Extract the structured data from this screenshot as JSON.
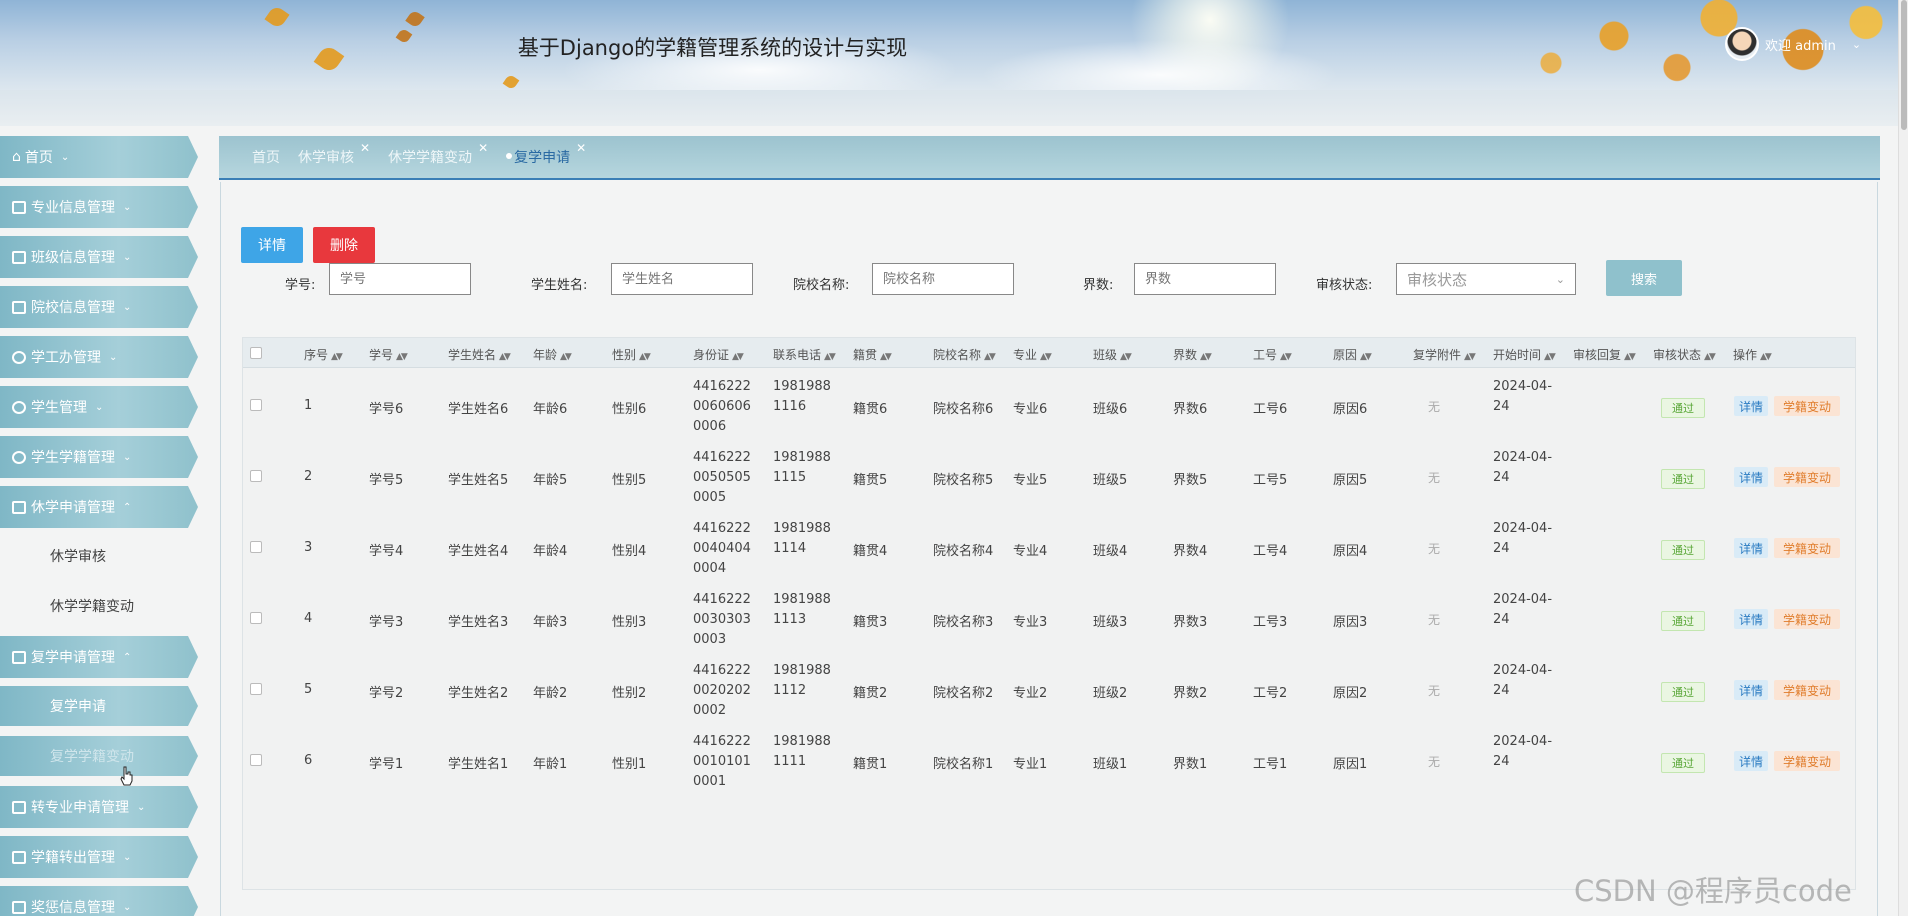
{
  "header": {
    "title": "基于Django的学籍管理系统的设计与实现",
    "welcome": "欢迎 admin"
  },
  "sidebar": {
    "items": [
      {
        "label": "首页",
        "icon": "home-icon"
      },
      {
        "label": "专业信息管理",
        "icon": "image-icon"
      },
      {
        "label": "班级信息管理",
        "icon": "table-icon"
      },
      {
        "label": "院校信息管理",
        "icon": "columns-icon"
      },
      {
        "label": "学工办管理",
        "icon": "user-icon"
      },
      {
        "label": "学生管理",
        "icon": "user-icon"
      },
      {
        "label": "学生学籍管理",
        "icon": "drop-icon"
      },
      {
        "label": "休学申请管理",
        "icon": "chart-icon"
      },
      {
        "label": "复学申请管理",
        "icon": "store-icon"
      },
      {
        "label": "转专业申请管理",
        "icon": "grid-icon"
      },
      {
        "label": "学籍转出管理",
        "icon": "table-icon"
      },
      {
        "label": "奖惩信息管理",
        "icon": "table-icon"
      }
    ],
    "sub_suspend": [
      "休学审核",
      "休学学籍变动"
    ],
    "sub_resume": [
      "复学申请",
      "复学学籍变动"
    ]
  },
  "tabs": [
    "首页",
    "休学审核",
    "休学学籍变动",
    "复学申请"
  ],
  "toolbar": {
    "detail": "详情",
    "delete": "删除",
    "search": "搜索"
  },
  "filters": {
    "student_no": {
      "label": "学号:",
      "placeholder": "学号"
    },
    "student_name": {
      "label": "学生姓名:",
      "placeholder": "学生姓名"
    },
    "school_name": {
      "label": "院校名称:",
      "placeholder": "院校名称"
    },
    "grade": {
      "label": "界数:",
      "placeholder": "界数"
    },
    "audit_status": {
      "label": "审核状态:",
      "placeholder": "审核状态"
    }
  },
  "table": {
    "headers": [
      "序号",
      "学号",
      "学生姓名",
      "年龄",
      "性别",
      "身份证",
      "联系电话",
      "籍贯",
      "院校名称",
      "专业",
      "班级",
      "界数",
      "工号",
      "原因",
      "复学附件",
      "开始时间",
      "审核回复",
      "审核状态",
      "操作"
    ],
    "rows": [
      {
        "seq": "1",
        "no": "学号6",
        "name": "学生姓名6",
        "age": "年龄6",
        "sex": "性别6",
        "id": "441622200606060006",
        "phone": "19819881116",
        "origin": "籍贯6",
        "school": "院校名称6",
        "major": "专业6",
        "cls": "班级6",
        "grade": "界数6",
        "staff": "工号6",
        "reason": "原因6",
        "attach": "无",
        "start": "2024-04-24",
        "status": "通过"
      },
      {
        "seq": "2",
        "no": "学号5",
        "name": "学生姓名5",
        "age": "年龄5",
        "sex": "性别5",
        "id": "441622200505050005",
        "phone": "19819881115",
        "origin": "籍贯5",
        "school": "院校名称5",
        "major": "专业5",
        "cls": "班级5",
        "grade": "界数5",
        "staff": "工号5",
        "reason": "原因5",
        "attach": "无",
        "start": "2024-04-24",
        "status": "通过"
      },
      {
        "seq": "3",
        "no": "学号4",
        "name": "学生姓名4",
        "age": "年龄4",
        "sex": "性别4",
        "id": "441622200404040004",
        "phone": "19819881114",
        "origin": "籍贯4",
        "school": "院校名称4",
        "major": "专业4",
        "cls": "班级4",
        "grade": "界数4",
        "staff": "工号4",
        "reason": "原因4",
        "attach": "无",
        "start": "2024-04-24",
        "status": "通过"
      },
      {
        "seq": "4",
        "no": "学号3",
        "name": "学生姓名3",
        "age": "年龄3",
        "sex": "性别3",
        "id": "441622200303030003",
        "phone": "19819881113",
        "origin": "籍贯3",
        "school": "院校名称3",
        "major": "专业3",
        "cls": "班级3",
        "grade": "界数3",
        "staff": "工号3",
        "reason": "原因3",
        "attach": "无",
        "start": "2024-04-24",
        "status": "通过"
      },
      {
        "seq": "5",
        "no": "学号2",
        "name": "学生姓名2",
        "age": "年龄2",
        "sex": "性别2",
        "id": "441622200202020002",
        "phone": "19819881112",
        "origin": "籍贯2",
        "school": "院校名称2",
        "major": "专业2",
        "cls": "班级2",
        "grade": "界数2",
        "staff": "工号2",
        "reason": "原因2",
        "attach": "无",
        "start": "2024-04-24",
        "status": "通过"
      },
      {
        "seq": "6",
        "no": "学号1",
        "name": "学生姓名1",
        "age": "年龄1",
        "sex": "性别1",
        "id": "441622200101010001",
        "phone": "19819881111",
        "origin": "籍贯1",
        "school": "院校名称1",
        "major": "专业1",
        "cls": "班级1",
        "grade": "界数1",
        "staff": "工号1",
        "reason": "原因1",
        "attach": "无",
        "start": "2024-04-24",
        "status": "通过"
      }
    ],
    "row_actions": {
      "detail": "详情",
      "change": "学籍变动"
    }
  },
  "watermark": "CSDN @程序员code",
  "colors": {
    "accent": "#8fc1cc",
    "primary": "#3ea5e7",
    "danger": "#e8383d",
    "success": "#58a636",
    "warning": "#e07d2c"
  }
}
